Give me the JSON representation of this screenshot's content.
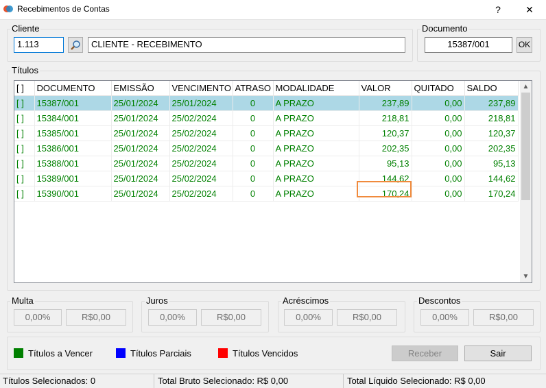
{
  "window": {
    "title": "Recebimentos de Contas",
    "help_label": "?",
    "close_label": "✕",
    "icon": "app-logo-icon"
  },
  "cliente": {
    "label": "Cliente",
    "code": "1.113",
    "name": "CLIENTE - RECEBIMENTO",
    "search_icon": "magnifier-icon"
  },
  "documento": {
    "label": "Documento",
    "value": "15387/001",
    "ok_label": "OK"
  },
  "titulos": {
    "label": "Títulos",
    "columns": [
      "[ ]",
      "DOCUMENTO",
      "EMISSÃO",
      "VENCIMENTO",
      "ATRASO",
      "MODALIDADE",
      "VALOR",
      "QUITADO",
      "SALDO"
    ],
    "rows": [
      {
        "check": "[ ]",
        "documento": "15387/001",
        "emissao": "25/01/2024",
        "vencimento": "25/01/2024",
        "atraso": "0",
        "modalidade": "A PRAZO",
        "valor": "237,89",
        "quitado": "0,00",
        "saldo": "237,89"
      },
      {
        "check": "[ ]",
        "documento": "15384/001",
        "emissao": "25/01/2024",
        "vencimento": "25/02/2024",
        "atraso": "0",
        "modalidade": "A PRAZO",
        "valor": "218,81",
        "quitado": "0,00",
        "saldo": "218,81"
      },
      {
        "check": "[ ]",
        "documento": "15385/001",
        "emissao": "25/01/2024",
        "vencimento": "25/02/2024",
        "atraso": "0",
        "modalidade": "A PRAZO",
        "valor": "120,37",
        "quitado": "0,00",
        "saldo": "120,37"
      },
      {
        "check": "[ ]",
        "documento": "15386/001",
        "emissao": "25/01/2024",
        "vencimento": "25/02/2024",
        "atraso": "0",
        "modalidade": "A PRAZO",
        "valor": "202,35",
        "quitado": "0,00",
        "saldo": "202,35"
      },
      {
        "check": "[ ]",
        "documento": "15388/001",
        "emissao": "25/01/2024",
        "vencimento": "25/02/2024",
        "atraso": "0",
        "modalidade": "A PRAZO",
        "valor": "95,13",
        "quitado": "0,00",
        "saldo": "95,13"
      },
      {
        "check": "[ ]",
        "documento": "15389/001",
        "emissao": "25/01/2024",
        "vencimento": "25/02/2024",
        "atraso": "0",
        "modalidade": "A PRAZO",
        "valor": "144,62",
        "quitado": "0,00",
        "saldo": "144,62"
      },
      {
        "check": "[ ]",
        "documento": "15390/001",
        "emissao": "25/01/2024",
        "vencimento": "25/02/2024",
        "atraso": "0",
        "modalidade": "A PRAZO",
        "valor": "170,24",
        "quitado": "0,00",
        "saldo": "170,24"
      }
    ],
    "row_text_color": "#008000",
    "selected_row_color": "#add8e6",
    "highlight_color": "#f08a3c"
  },
  "multa": {
    "label": "Multa",
    "percent": "0,00%",
    "amount": "R$0,00"
  },
  "juros": {
    "label": "Juros",
    "percent": "0,00%",
    "amount": "R$0,00"
  },
  "acrescimos": {
    "label": "Acréscimos",
    "percent": "0,00%",
    "amount": "R$0,00"
  },
  "descontos": {
    "label": "Descontos",
    "percent": "0,00%",
    "amount": "R$0,00"
  },
  "legend": [
    {
      "label": "Títulos a Vencer",
      "color": "#008000"
    },
    {
      "label": "Títulos Parciais",
      "color": "#0000ff"
    },
    {
      "label": "Títulos Vencidos",
      "color": "#ff0000"
    }
  ],
  "actions": {
    "receber_label": "Receber",
    "sair_label": "Sair"
  },
  "status": {
    "selecionados": "Títulos Selecionados: 0",
    "bruto": "Total Bruto Selecionado: R$ 0,00",
    "liquido": "Total Líquido Selecionado: R$ 0,00"
  }
}
